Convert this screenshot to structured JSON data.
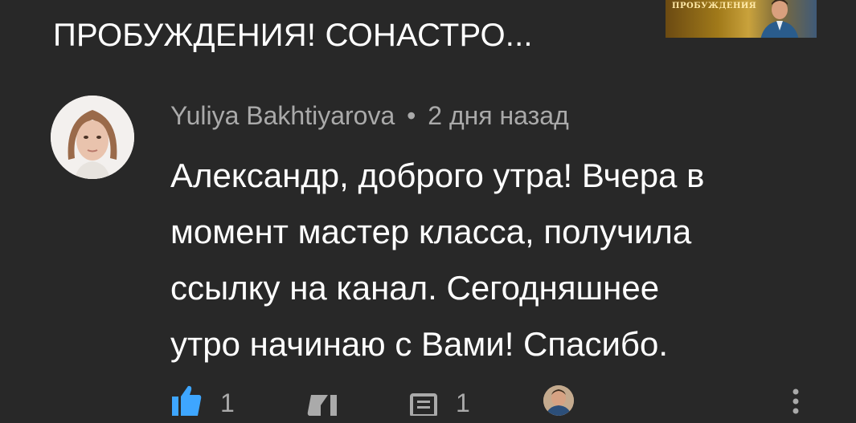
{
  "video": {
    "title": "ПРОБУЖДЕНИЯ! СОНАСТРО...",
    "thumbnail_text": "ПРОБУЖДЕНИЯ"
  },
  "comment": {
    "author": "Yuliya Bakhtiyarova",
    "separator": "•",
    "time": "2 дня назад",
    "text_lines": [
      "Александр, доброго утра! Вчера в",
      "момент мастер класса, получила",
      "ссылку на канал. Сегодняшнее",
      "утро начинаю с Вами! Спасибо."
    ]
  },
  "actions": {
    "likes": "1",
    "replies": "1",
    "like_icon": "thumbs-up-icon",
    "dislike_icon": "thumbs-down-icon",
    "reply_icon": "comment-icon",
    "more_icon": "more-vertical-icon"
  },
  "colors": {
    "background": "#282828",
    "primary_text": "#ffffff",
    "secondary_text": "#aaaaaa",
    "like_active": "#3ea6ff"
  }
}
